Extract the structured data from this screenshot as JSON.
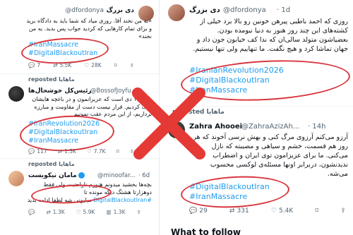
{
  "left_panel": {
    "tweet1": {
      "author_name": "دی بزرگ",
      "handle": "@dfordonya",
      "time": "· 6d",
      "body": "«به من نخند آقا. روزی میاد که شما باید به دادگاه برید و برای تمام کارهایی که کردید جواب پس بدید. به من نخند»",
      "hashtags": [
        "#IranMassacre",
        "#DigitalBlackoutIran"
      ],
      "metrics": {
        "replies": "7",
        "reposts": "5.5K",
        "likes": "28K"
      }
    },
    "repost1": "reposted ماهایا",
    "tweet2": {
      "author_name": "رئیس‌کل خوشحال‌ها",
      "handle": "@BossofJoyfu...",
      "body": "هنوز ۱۴ دی است که عزیزانمون و در باغچه هایشان خاک کردیم. قرار نیست دست از مقاومت و مبارزه برداریم، از این مردم عقب نمونیم",
      "hashtags": [
        "#IranRevolution2026",
        "#DigitalBlackoutIran",
        "#IranMassacre"
      ],
      "metrics": {
        "replies": "117",
        "reposts": "1.5K",
        "likes": "7.7K"
      }
    },
    "repost2": "reposted ماهایا",
    "tweet3": {
      "author_name": "مامان نیکویست",
      "handle": "@minoofar...",
      "time": "· 6d",
      "body": "بچه‌ها بخشید میدونم هنوزم ناراحتیت ولی فقط دوهزارتا هشتگ دیگه مونده تا",
      "hashtag_inline": "#DigitalBlackoutIran",
      "body_end": "میلیونی شه لطفا ادامه بدید",
      "metrics": {
        "replies": "",
        "reposts": "1.3K",
        "likes": "5.9K",
        "views": "1.3K"
      }
    }
  },
  "right_panel": {
    "tweet1": {
      "author_name": "دی بزرگ",
      "handle": "@dfordonya",
      "time": "· 1d",
      "body": "روزی که احمد باطبی پیرهن خونین رو بالا برد خیلی از کشته‌های این چند روز هنوز به دنیا نیومده بودن. بعضیاشون متولد سالی‌ان که ندا کف خیابون جون داد و جهان تماشا کرد و هیچ نگفت. ما تنهاییم ولی تنها نیستیم.",
      "hashtags": [
        "#IranianRevolution2026",
        "#DigitalBlackoutIran",
        "#IranMassacre"
      ]
    },
    "repost": "reposted ماهایا",
    "tweet2": {
      "author_name": "Zahra Ahooei",
      "handle": "@ZahraAzizAh...",
      "time": "· 14h",
      "body": "آرزو می‌کنم آرزوی مرگ کنی و بهش نرسی آخوند که هر روز هم قسمت، خشم و سیاهی و مصیبته که نازل می‌کنی. ما برای عزیزامون توی ایران و اضطراب ندیدنشون، دربرابر اونها مسئله‌ی لوکسی محسوب می‌شه.",
      "hashtags": [
        "#DigitalBlackoutIran",
        "#IranMassacre"
      ],
      "metrics": {
        "replies": "29",
        "reposts": "331",
        "likes": "5.4K"
      }
    },
    "footer": "What to follow"
  },
  "colors": {
    "accent": "#1d9bf0",
    "annotation_red": "#d9363e",
    "cross_red": "#e53935",
    "muted": "#536471"
  }
}
